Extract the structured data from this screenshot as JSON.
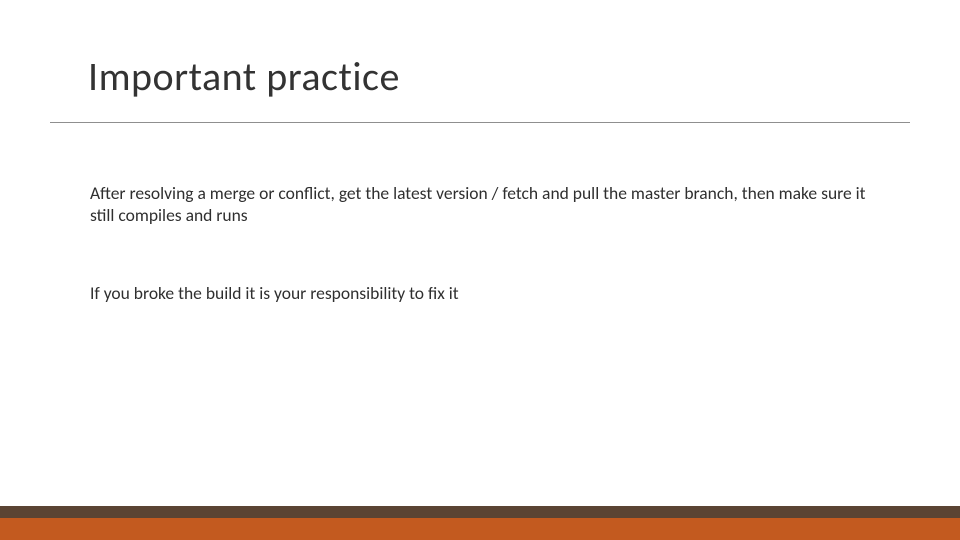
{
  "slide": {
    "title": "Important practice",
    "paragraphs": [
      "After resolving a merge or conflict, get the latest version / fetch and pull the master branch, then make sure it still compiles and runs",
      "If you broke the build it is your responsibility to fix it"
    ]
  },
  "theme": {
    "footer_top_color": "#5b4433",
    "footer_bottom_color": "#c35a1f"
  }
}
